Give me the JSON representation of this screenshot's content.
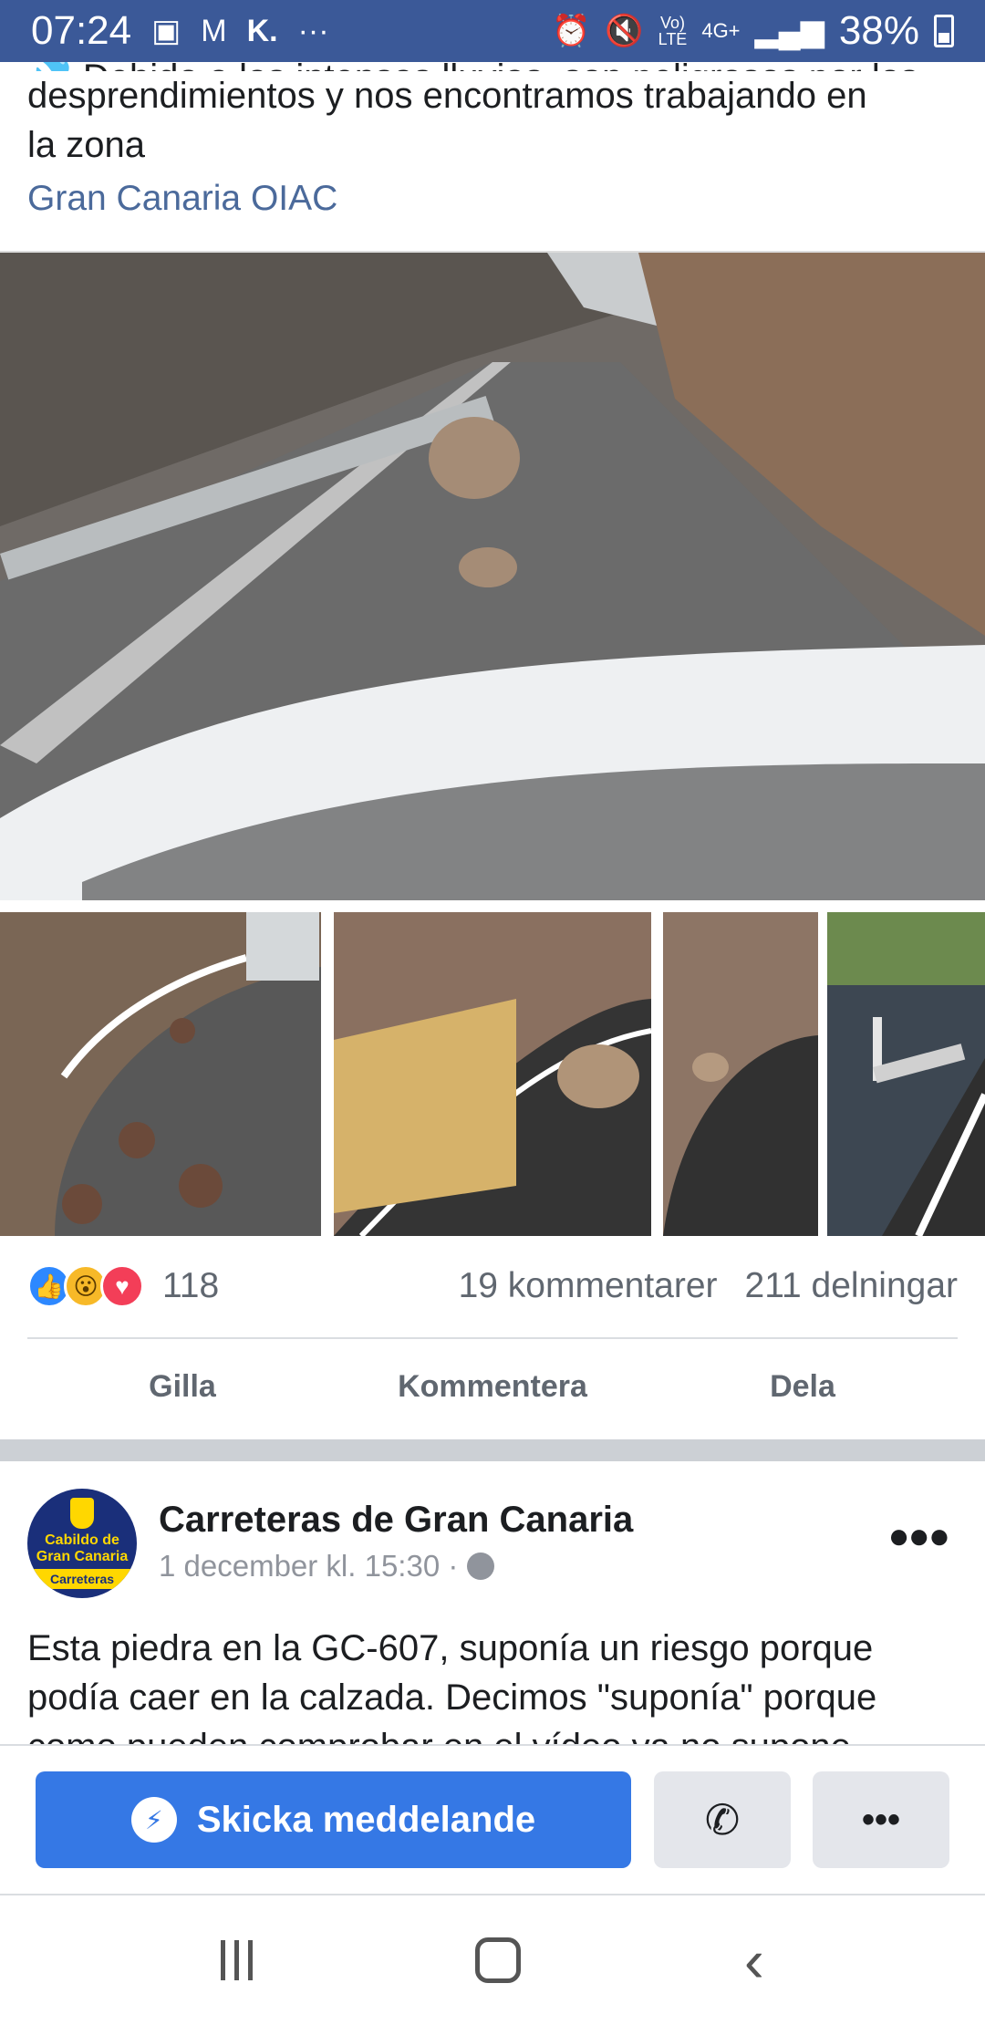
{
  "status_bar": {
    "time": "07:24",
    "left_icons": [
      "image-icon",
      "gmail-icon",
      "k-icon",
      "more-dots-icon"
    ],
    "right_icons": [
      "alarm-icon",
      "mute-icon",
      "volte-icon",
      "4g-icon",
      "signal-icon"
    ],
    "network_top": "Vo)",
    "network_bottom": "LTE",
    "net_type": "4G+",
    "battery": "38%"
  },
  "post1": {
    "text_cut_line": "💦 Debido a las intensas lluvias, son peligrosos por los",
    "text_line2": "desprendimientos y nos encontramos trabajando en",
    "text_line3": "la zona",
    "link": "Gran Canaria OIAC",
    "reaction_count": "118",
    "comments": "19 kommentarer",
    "shares": "211 delningar",
    "actions": {
      "like": "Gilla",
      "comment": "Kommentera",
      "share": "Dela"
    }
  },
  "post2": {
    "avatar_line1": "Cabildo de",
    "avatar_line2": "Gran Canaria",
    "avatar_band": "Carreteras",
    "page_name": "Carreteras de Gran Canaria",
    "timestamp": "1 december kl. 15:30 ·",
    "text": "Esta piedra en la GC-607, suponía un riesgo porque podía caer en la calzada. Decimos \"suponía\" porque como pueden comprobar en el vídeo ya no supone"
  },
  "message_bar": {
    "send_label": "Skicka meddelande",
    "more_label": "•••"
  },
  "colors": {
    "statusbar": "#3b5998",
    "button_blue": "#3578e5",
    "link": "#4b6a9b"
  }
}
